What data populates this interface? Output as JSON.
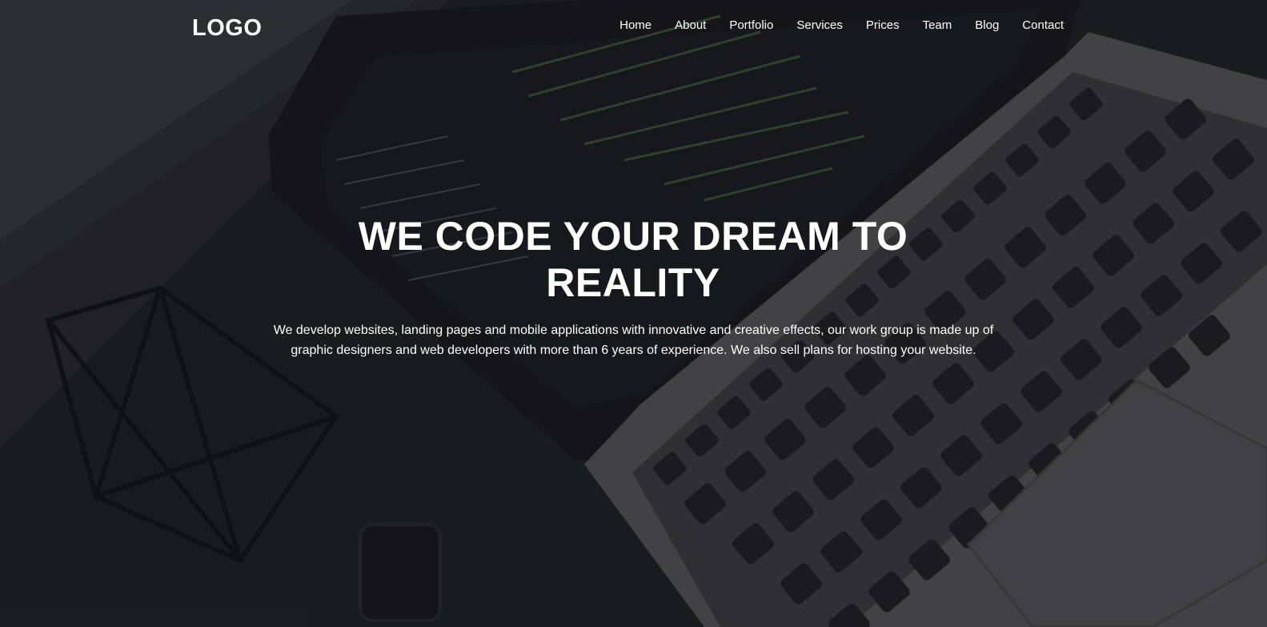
{
  "logo": {
    "text": "LOGO"
  },
  "nav": {
    "items": [
      {
        "label": "Home"
      },
      {
        "label": "About"
      },
      {
        "label": "Portfolio"
      },
      {
        "label": "Services"
      },
      {
        "label": "Prices"
      },
      {
        "label": "Team"
      },
      {
        "label": "Blog"
      },
      {
        "label": "Contact"
      }
    ]
  },
  "hero": {
    "headline_line1": "WE CODE YOUR DREAM TO",
    "headline_line2": "REALITY",
    "description": "We develop websites, landing pages and mobile applications with innovative and creative effects, our work group is made up of graphic designers and web developers with more than 6 years of experience. We also sell plans for hosting your website.",
    "background_image": "laptop-with-code-photo"
  },
  "colors": {
    "text": "#ffffff",
    "background": "#1d1e22",
    "laptop_body": "#5a5a5c",
    "keys": "#1e1f22"
  }
}
